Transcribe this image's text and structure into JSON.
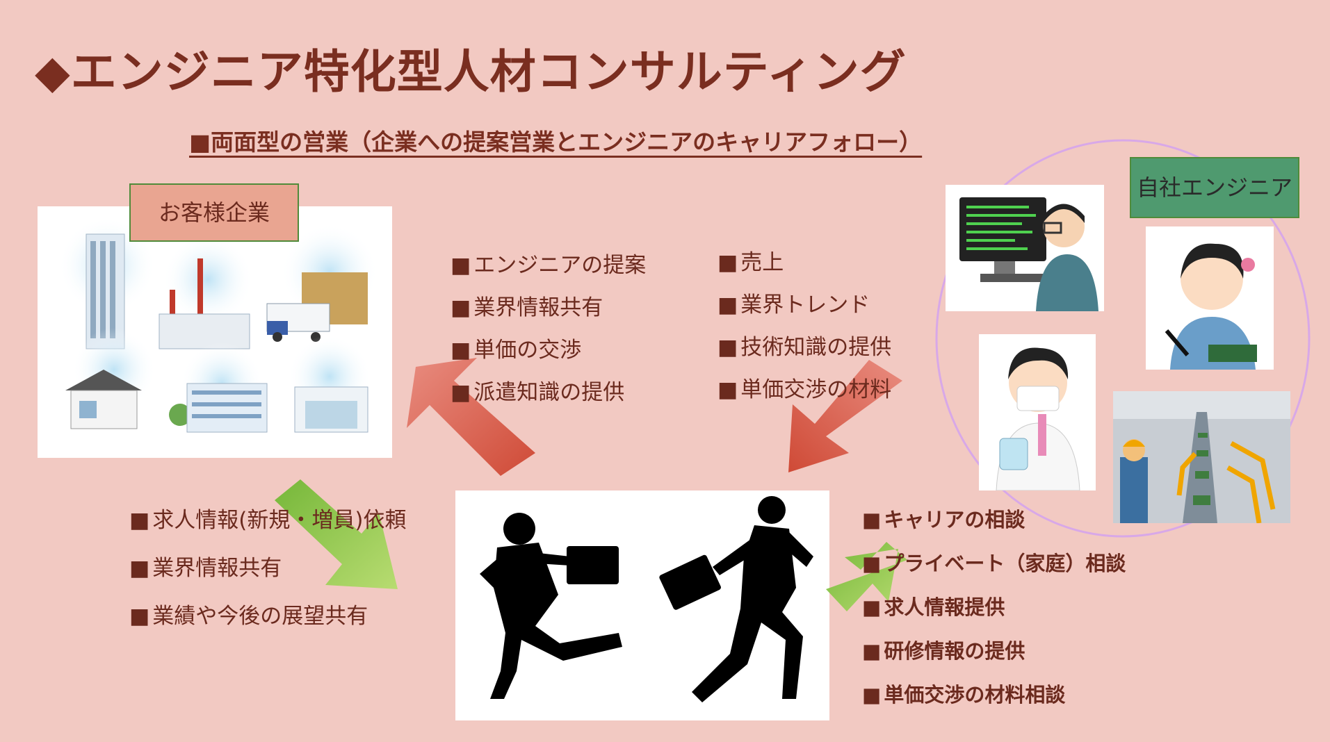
{
  "title": "◆エンジニア特化型人材コンサルティング",
  "subtitle": "■両面型の営業（企業への提案営業とエンジニアのキャリアフォロー）",
  "labels": {
    "customer": "お客様企業",
    "engineer": "自社エンジニア"
  },
  "lists": {
    "to_customer": [
      "エンジニアの提案",
      "業界情報共有",
      "単価の交渉",
      "派遣知識の提供"
    ],
    "from_customer": [
      "売上",
      "業界トレンド",
      "技術知識の提供",
      "単価交渉の材料"
    ],
    "customer_requests": [
      "求人情報(新規・増員)依頼",
      "業界情報共有",
      "業績や今後の展望共有"
    ],
    "engineer_support": [
      "キャリアの相談",
      "プライベート（家庭）相談",
      "求人情報提供",
      "研修情報の提供",
      "単価交渉の材料相談"
    ]
  },
  "colors": {
    "background": "#f2c9c2",
    "red_arrow": "#d9533f",
    "green_arrow": "#8cc63f",
    "circle": "#d8a8e8"
  }
}
